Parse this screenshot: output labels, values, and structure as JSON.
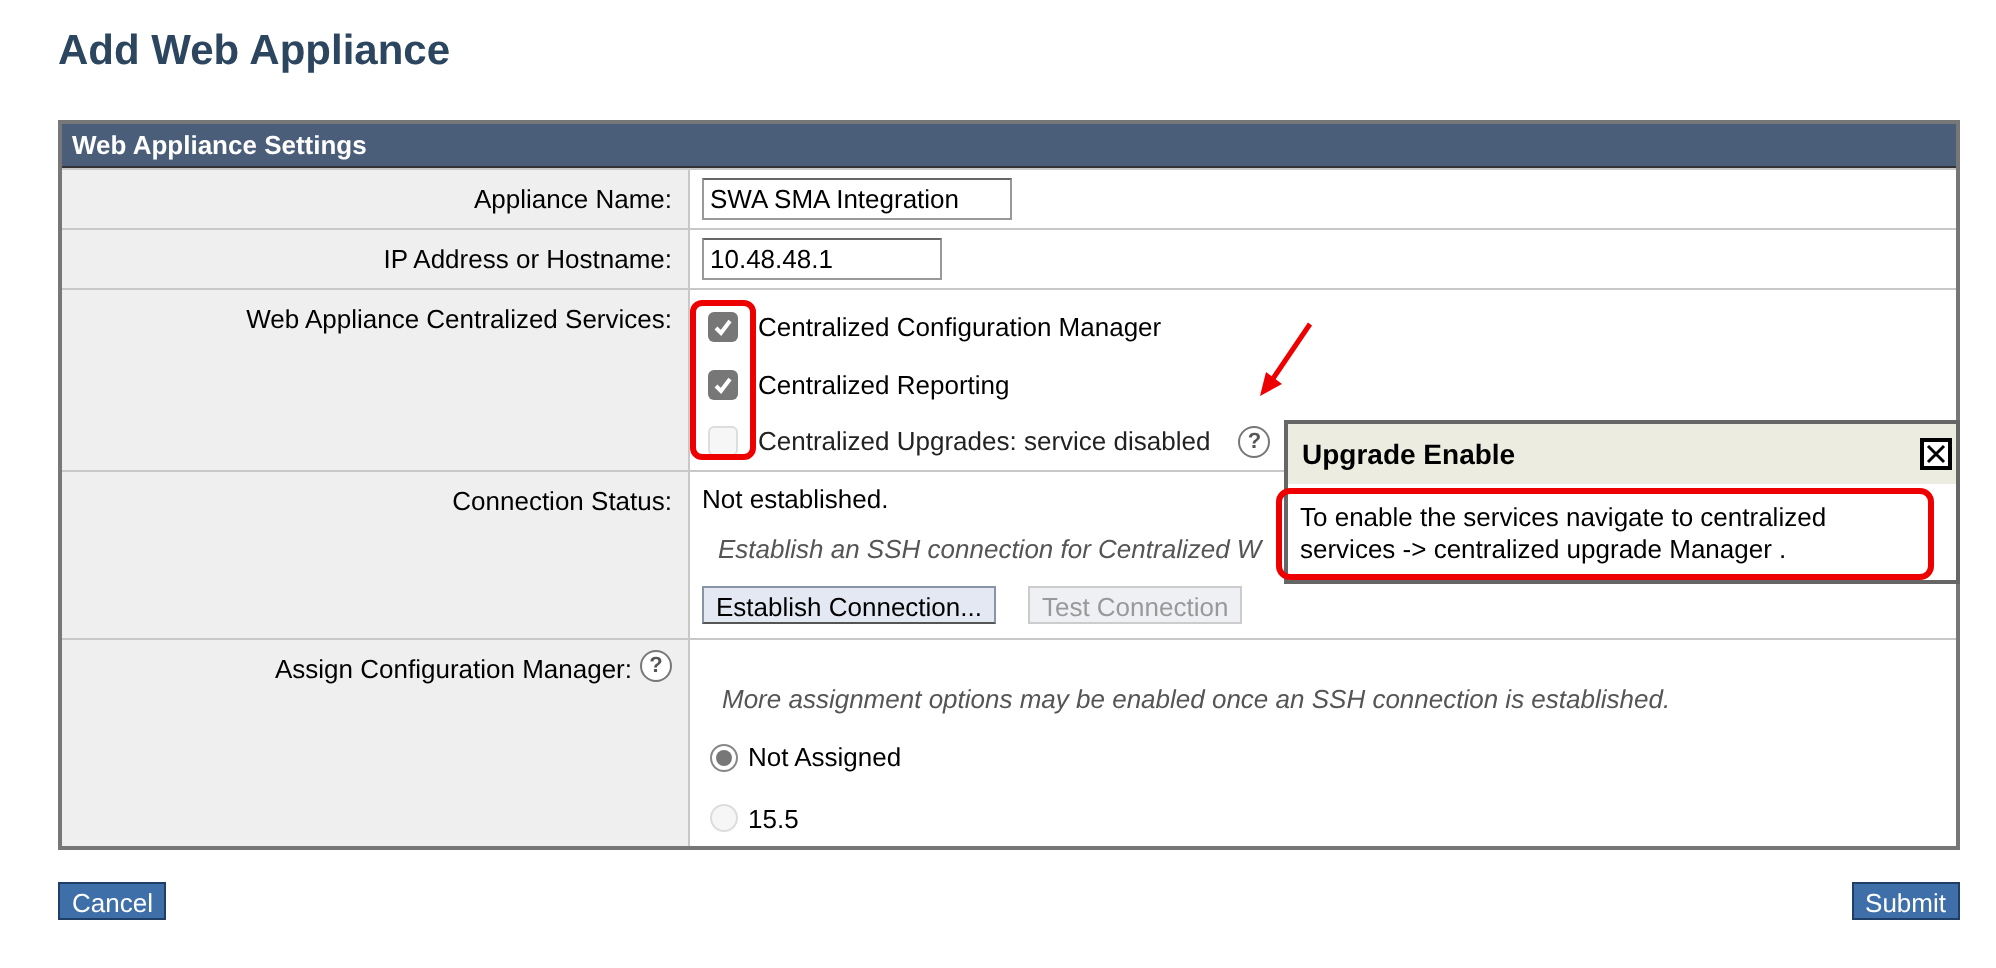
{
  "page_title": "Add Web Appliance",
  "panel": {
    "title": "Web Appliance Settings",
    "rows": [
      {
        "kind": "text_field",
        "label": "Appliance Name:",
        "value": "SWA SMA Integration"
      },
      {
        "kind": "text_field",
        "label": "IP Address or Hostname:",
        "value": "10.48.48.1"
      },
      {
        "kind": "checkboxes",
        "label": "Web Appliance Centralized Services:",
        "options": [
          {
            "label": "Centralized Configuration Manager",
            "checked": true,
            "disabled": false
          },
          {
            "label": "Centralized Reporting",
            "checked": true,
            "disabled": false
          },
          {
            "label": "Centralized Upgrades: service disabled",
            "checked": false,
            "disabled": true,
            "help": "?"
          }
        ]
      },
      {
        "kind": "connection",
        "label": "Connection Status:",
        "status": "Not established.",
        "hint": "Establish an SSH connection for Centralized W",
        "buttons": [
          {
            "label": "Establish Connection...",
            "disabled": false
          },
          {
            "label": "Test Connection",
            "disabled": true
          }
        ]
      },
      {
        "kind": "radios",
        "label": "Assign Configuration Manager:",
        "help": "?",
        "hint": "More assignment options may be enabled once an SSH connection is established.",
        "options": [
          {
            "label": "Not Assigned",
            "selected": true
          },
          {
            "label": "15.5",
            "selected": false
          }
        ]
      }
    ]
  },
  "tooltip": {
    "title": "Upgrade Enable",
    "text": "To enable the services navigate to centralized services -> centralized upgrade Manager ."
  },
  "buttons": [
    {
      "label": "Cancel"
    },
    {
      "label": "Submit"
    }
  ]
}
